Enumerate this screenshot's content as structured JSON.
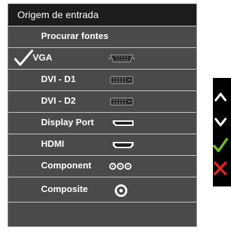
{
  "menu": {
    "title": "Origem de entrada",
    "items": [
      {
        "label": "Procurar fontes"
      },
      {
        "label": "VGA",
        "selected": true,
        "icon": "vga-port-icon"
      },
      {
        "label": "DVI - D1",
        "icon": "dvi-port-icon"
      },
      {
        "label": "DVI - D2",
        "icon": "dvi-port-icon"
      },
      {
        "label": "Display Port",
        "icon": "displayport-icon"
      },
      {
        "label": "HDMI",
        "icon": "hdmi-port-icon"
      },
      {
        "label": "Component",
        "icon": "component-ports-icon"
      },
      {
        "label": "Composite",
        "icon": "composite-port-icon"
      }
    ]
  },
  "nav_buttons": [
    "chevron-up-icon",
    "chevron-down-icon",
    "checkmark-icon",
    "close-icon"
  ],
  "colors": {
    "title_bg": "#1c1c1c",
    "menu_bg": "#4a4a4a",
    "selected_check": "#ffffff",
    "nav_ok": "#6ec21f",
    "nav_close": "#e3261c"
  }
}
